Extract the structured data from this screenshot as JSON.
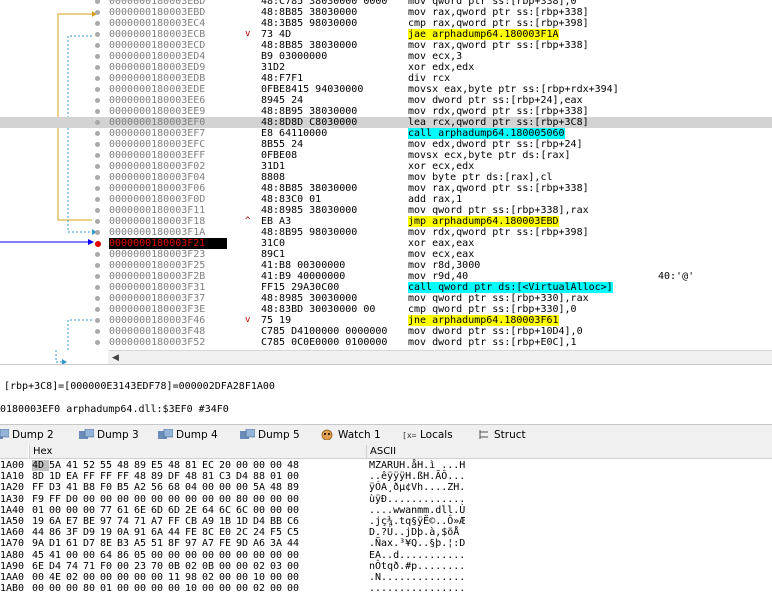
{
  "disasm": {
    "rows": [
      {
        "addr": "0000000180003EBD",
        "bytes": "48:C785 38030000 0000",
        "instr": "mov qword ptr ss:[rbp+338],0",
        "mark": "",
        "comment": ""
      },
      {
        "addr": "0000000180003EBD",
        "bytes": "48:8B85 38030000",
        "instr": "mov rax,qword ptr ss:[rbp+338]",
        "mark": "",
        "comment": ""
      },
      {
        "addr": "0000000180003EC4",
        "bytes": "48:3B85 98030000",
        "instr": "cmp rax,qword ptr ss:[rbp+398]",
        "mark": "",
        "comment": ""
      },
      {
        "addr": "0000000180003ECB",
        "bytes": "73 4D",
        "instr": "jae arphadump64.180003F1A",
        "mark": "v",
        "comment": ""
      },
      {
        "addr": "0000000180003ECD",
        "bytes": "48:8B85 38030000",
        "instr": "mov rax,qword ptr ss:[rbp+338]",
        "mark": "",
        "comment": ""
      },
      {
        "addr": "0000000180003ED4",
        "bytes": "B9 03000000",
        "instr": "mov ecx,3",
        "mark": "",
        "comment": ""
      },
      {
        "addr": "0000000180003ED9",
        "bytes": "31D2",
        "instr": "xor edx,edx",
        "mark": "",
        "comment": ""
      },
      {
        "addr": "0000000180003EDB",
        "bytes": "48:F7F1",
        "instr": "div rcx",
        "mark": "",
        "comment": ""
      },
      {
        "addr": "0000000180003EDE",
        "bytes": "0FBE8415 94030000",
        "instr": "movsx eax,byte ptr ss:[rbp+rdx+394]",
        "mark": "",
        "comment": ""
      },
      {
        "addr": "0000000180003EE6",
        "bytes": "8945 24",
        "instr": "mov dword ptr ss:[rbp+24],eax",
        "mark": "",
        "comment": ""
      },
      {
        "addr": "0000000180003EE9",
        "bytes": "48:8B95 38030000",
        "instr": "mov rdx,qword ptr ss:[rbp+338]",
        "mark": "",
        "comment": ""
      },
      {
        "addr": "0000000180003EF0",
        "bytes": "48:8D8D C8030000",
        "instr": "lea rcx,qword ptr ss:[rbp+3C8]",
        "mark": "",
        "comment": ""
      },
      {
        "addr": "0000000180003EF7",
        "bytes": "E8 64110000",
        "instr": "call arphadump64.180005060",
        "mark": "",
        "comment": ""
      },
      {
        "addr": "0000000180003EFC",
        "bytes": "8B55 24",
        "instr": "mov edx,dword ptr ss:[rbp+24]",
        "mark": "",
        "comment": ""
      },
      {
        "addr": "0000000180003EFF",
        "bytes": "0FBE08",
        "instr": "movsx ecx,byte ptr ds:[rax]",
        "mark": "",
        "comment": ""
      },
      {
        "addr": "0000000180003F02",
        "bytes": "31D1",
        "instr": "xor ecx,edx",
        "mark": "",
        "comment": ""
      },
      {
        "addr": "0000000180003F04",
        "bytes": "8808",
        "instr": "mov byte ptr ds:[rax],cl",
        "mark": "",
        "comment": ""
      },
      {
        "addr": "0000000180003F06",
        "bytes": "48:8B85 38030000",
        "instr": "mov rax,qword ptr ss:[rbp+338]",
        "mark": "",
        "comment": ""
      },
      {
        "addr": "0000000180003F0D",
        "bytes": "48:83C0 01",
        "instr": "add rax,1",
        "mark": "",
        "comment": ""
      },
      {
        "addr": "0000000180003F11",
        "bytes": "48:8985 38030000",
        "instr": "mov qword ptr ss:[rbp+338],rax",
        "mark": "",
        "comment": ""
      },
      {
        "addr": "0000000180003F18",
        "bytes": "EB A3",
        "instr": "jmp arphadump64.180003EBD",
        "mark": "^",
        "comment": ""
      },
      {
        "addr": "0000000180003F1A",
        "bytes": "48:8B95 98030000",
        "instr": "mov rdx,qword ptr ss:[rbp+398]",
        "mark": "",
        "comment": ""
      },
      {
        "addr": "0000000180003F21",
        "bytes": "31C0",
        "instr": "xor eax,eax",
        "mark": "",
        "comment": ""
      },
      {
        "addr": "0000000180003F23",
        "bytes": "89C1",
        "instr": "mov ecx,eax",
        "mark": "",
        "comment": ""
      },
      {
        "addr": "0000000180003F25",
        "bytes": "41:B8 00300000",
        "instr": "mov r8d,3000",
        "mark": "",
        "comment": ""
      },
      {
        "addr": "0000000180003F2B",
        "bytes": "41:B9 40000000",
        "instr": "mov r9d,40",
        "mark": "",
        "comment": "40:'@'"
      },
      {
        "addr": "0000000180003F31",
        "bytes": "FF15 29A30C00",
        "instr": "call qword ptr ds:[<VirtualAlloc>]",
        "mark": "",
        "comment": ""
      },
      {
        "addr": "0000000180003F37",
        "bytes": "48:8985 30030000",
        "instr": "mov qword ptr ss:[rbp+330],rax",
        "mark": "",
        "comment": ""
      },
      {
        "addr": "0000000180003F3E",
        "bytes": "48:83BD 30030000 00",
        "instr": "cmp qword ptr ss:[rbp+330],0",
        "mark": "",
        "comment": ""
      },
      {
        "addr": "0000000180003F46",
        "bytes": "75 19",
        "instr": "jne arphadump64.180003F61",
        "mark": "v",
        "comment": ""
      },
      {
        "addr": "0000000180003F48",
        "bytes": "C785 D4100000 0000000",
        "instr": "mov dword ptr ss:[rbp+10D4],0",
        "mark": "",
        "comment": ""
      },
      {
        "addr": "0000000180003F52",
        "bytes": "C785 0C0E0000 0100000",
        "instr": "mov dword ptr ss:[rbp+E0C],1",
        "mark": "",
        "comment": ""
      }
    ]
  },
  "info": {
    "line1": "[rbp+3C8]=[000000E3143EDF78]=000002DFA28F1A00",
    "line2": "0180003EF0 arphadump64.dll:$3EF0 #34F0"
  },
  "tabs": [
    {
      "label": "Dump 2",
      "icon": "dump-icon"
    },
    {
      "label": "Dump 3",
      "icon": "dump-icon"
    },
    {
      "label": "Dump 4",
      "icon": "dump-icon"
    },
    {
      "label": "Dump 5",
      "icon": "dump-icon"
    },
    {
      "label": "Watch 1",
      "icon": "watch-icon"
    },
    {
      "label": "Locals",
      "icon": "locals-icon"
    },
    {
      "label": "Struct",
      "icon": "struct-icon"
    }
  ],
  "hex": {
    "col_hex": "Hex",
    "col_ascii": "ASCII",
    "rows": [
      {
        "addr": "1A00",
        "bytes": [
          "4D",
          "5A",
          "41",
          "52",
          "55",
          "48",
          "89",
          "E5",
          "48",
          "81",
          "EC",
          "20",
          "00",
          "00",
          "00",
          "48"
        ],
        "ascii": "MZARUH.åH.ì ...H"
      },
      {
        "addr": "1A10",
        "bytes": [
          "8D",
          "1D",
          "EA",
          "FF",
          "FF",
          "FF",
          "48",
          "89",
          "DF",
          "48",
          "81",
          "C3",
          "D4",
          "88",
          "01",
          "00"
        ],
        "ascii": "..êÿÿÿH.ßH.ÃÔ..."
      },
      {
        "addr": "1A20",
        "bytes": [
          "FF",
          "D3",
          "41",
          "B8",
          "F0",
          "B5",
          "A2",
          "56",
          "68",
          "04",
          "00",
          "00",
          "00",
          "5A",
          "48",
          "89"
        ],
        "ascii": "ÿÓA¸ðµ¢Vh....ZH."
      },
      {
        "addr": "1A30",
        "bytes": [
          "F9",
          "FF",
          "D0",
          "00",
          "00",
          "00",
          "00",
          "00",
          "00",
          "00",
          "00",
          "00",
          "80",
          "00",
          "00",
          "00"
        ],
        "ascii": "ùÿÐ............."
      },
      {
        "addr": "1A40",
        "bytes": [
          "01",
          "00",
          "00",
          "00",
          "77",
          "61",
          "6E",
          "6D",
          "6D",
          "2E",
          "64",
          "6C",
          "6C",
          "00",
          "00",
          "00"
        ],
        "ascii": "....wwanmm.dll.Ù"
      },
      {
        "addr": "1A50",
        "bytes": [
          "19",
          "6A",
          "E7",
          "BE",
          "97",
          "74",
          "71",
          "A7",
          "FF",
          "CB",
          "A9",
          "1B",
          "1D",
          "D4",
          "BB",
          "C6"
        ],
        "ascii": ".jç¾.tq§ÿË©..Ô»Æ"
      },
      {
        "addr": "1A60",
        "bytes": [
          "44",
          "86",
          "3F",
          "D9",
          "19",
          "0A",
          "91",
          "6A",
          "44",
          "FE",
          "8C",
          "E0",
          "2C",
          "24",
          "F5",
          "C5"
        ],
        "ascii": "D.?Ù..jDþ.à,$õÅ"
      },
      {
        "addr": "1A70",
        "bytes": [
          "9A",
          "D1",
          "61",
          "D7",
          "8E",
          "B3",
          "A5",
          "51",
          "8F",
          "97",
          "A7",
          "FE",
          "9D",
          "A6",
          "3A",
          "44"
        ],
        "ascii": ".Ñax.³¥Q..§þ.¦:D"
      },
      {
        "addr": "1A80",
        "bytes": [
          "45",
          "41",
          "00",
          "00",
          "64",
          "86",
          "05",
          "00",
          "00",
          "00",
          "00",
          "00",
          "00",
          "00",
          "00",
          "00"
        ],
        "ascii": "EA..d..........."
      },
      {
        "addr": "1A90",
        "bytes": [
          "6E",
          "D4",
          "74",
          "71",
          "F0",
          "00",
          "23",
          "70",
          "0B",
          "02",
          "0B",
          "00",
          "00",
          "02",
          "03",
          "00"
        ],
        "ascii": "nÔtqð.#p........"
      },
      {
        "addr": "1AA0",
        "bytes": [
          "00",
          "4E",
          "02",
          "00",
          "00",
          "00",
          "00",
          "00",
          "11",
          "98",
          "02",
          "00",
          "00",
          "10",
          "00",
          "00"
        ],
        "ascii": ".N.............."
      },
      {
        "addr": "1AB0",
        "bytes": [
          "00",
          "00",
          "00",
          "80",
          "01",
          "00",
          "00",
          "00",
          "00",
          "10",
          "00",
          "00",
          "00",
          "02",
          "00",
          "00"
        ],
        "ascii": "................"
      }
    ]
  }
}
